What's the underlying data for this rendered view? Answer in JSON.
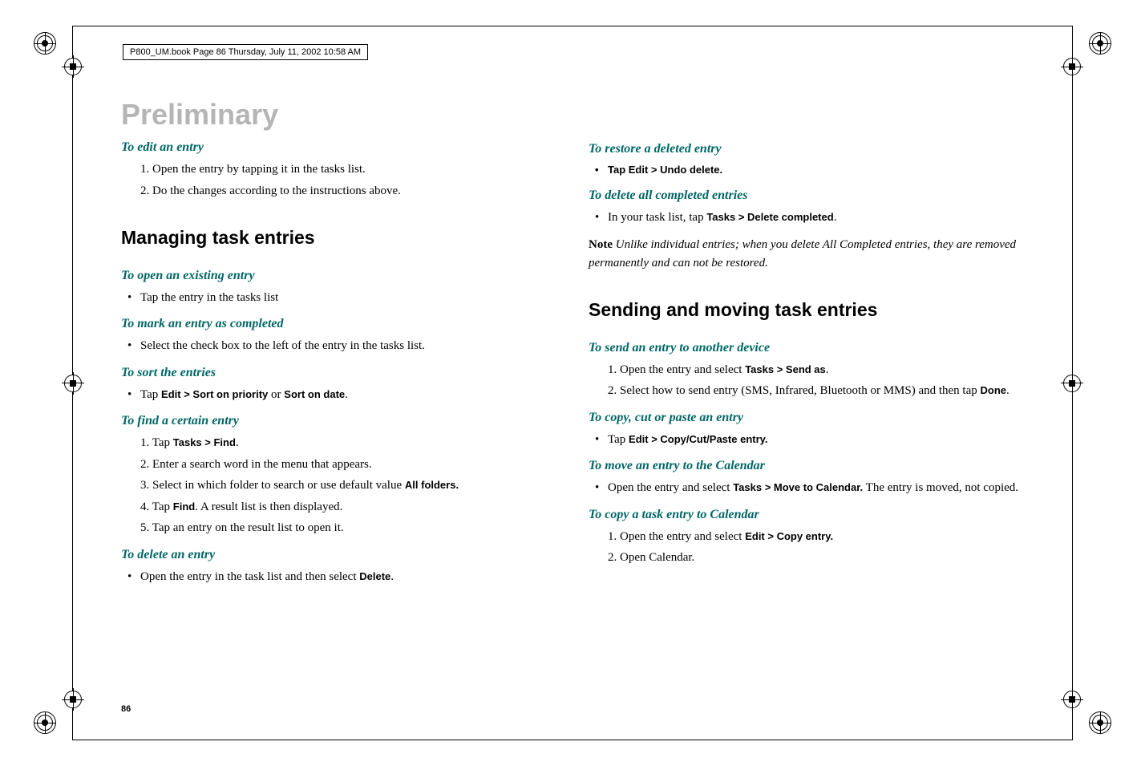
{
  "header": "P800_UM.book  Page 86  Thursday, July 11, 2002  10:58 AM",
  "watermark": "Preliminary",
  "left": {
    "h3_1": "To edit an entry",
    "l1": "1.  Open the entry by tapping it in the tasks list.",
    "l2": "2.  Do the changes according to the instructions above.",
    "h2_1": "Managing task entries",
    "h3_2": "To open an existing entry",
    "l3": "Tap the entry in the tasks list",
    "h3_3": "To mark an entry as completed",
    "l4": "Select the check box to the left of the entry in the tasks list.",
    "h3_4": "To sort the entries",
    "l5a": "Tap ",
    "l5b": "Edit > Sort on priority",
    "l5c": " or ",
    "l5d": "Sort on date",
    "l5e": ".",
    "h3_5": "To find a certain entry",
    "l6a": "1.  Tap ",
    "l6b": "Tasks > Find",
    "l6c": ".",
    "l7": "2.  Enter a search word in the menu that appears.",
    "l8a": "3.  Select in which folder to search or use default value ",
    "l8b": "All folders",
    "l8c": ".",
    "l9a": "4.  Tap ",
    "l9b": "Find",
    "l9c": ". A result list is then displayed.",
    "l10": "5.  Tap an entry on the result list to open it.",
    "h3_6": "To delete an entry",
    "l11a": "Open the entry in the task list and then select ",
    "l11b": "Delete",
    "l11c": "."
  },
  "right": {
    "h3_1": "To restore a deleted entry",
    "l1": "Tap Edit > Undo delete.",
    "h3_2": "To delete all completed entries",
    "l2a": "In your task list, tap ",
    "l2b": "Tasks > Delete completed",
    "l2c": ".",
    "note_label": "Note",
    "note_text": " Unlike individual entries; when you delete All Completed entries, they are removed permanently and can not be restored.",
    "h2_1": "Sending and moving task entries",
    "h3_3": "To send an entry to another device",
    "l3a": "1.  Open the entry and select ",
    "l3b": "Tasks > Send as",
    "l3c": ".",
    "l4a": "2.  Select how to send entry (SMS, Infrared, Bluetooth or MMS) and then tap ",
    "l4b": "Done",
    "l4c": ".",
    "h3_4": "To copy, cut or paste an entry",
    "l5a": "Tap ",
    "l5b": "Edit > Copy/Cut/Paste entry.",
    "h3_5": "To move an entry to the Calendar",
    "l6a": "Open the entry and select ",
    "l6b": "Tasks > Move to Calendar.",
    "l6c": " The entry is moved, not copied.",
    "h3_6": "To copy a task entry to Calendar",
    "l7a": "1.  Open the entry and select ",
    "l7b": "Edit > Copy entry.",
    "l8": "2.  Open Calendar."
  },
  "page_number": "86"
}
